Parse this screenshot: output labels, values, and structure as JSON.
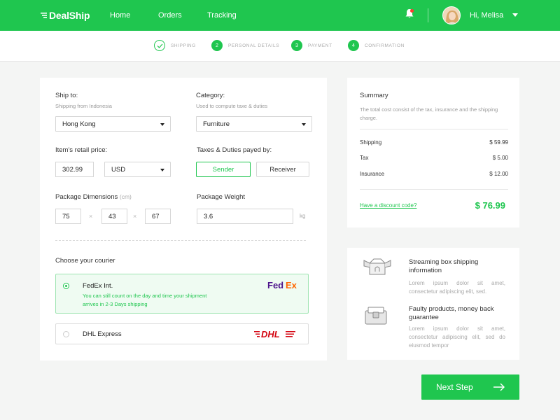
{
  "brand": {
    "name": "DealShip"
  },
  "nav": {
    "home": "Home",
    "orders": "Orders",
    "tracking": "Tracking"
  },
  "user": {
    "greeting": "Hi, Melisa"
  },
  "steps": [
    {
      "num": "",
      "label": "SHIPPING",
      "status": "done"
    },
    {
      "num": "2",
      "label": "PERSONAL DETAILS",
      "status": "active"
    },
    {
      "num": "3",
      "label": "PAYMENT",
      "status": "active"
    },
    {
      "num": "4",
      "label": "CONFIRMATION",
      "status": "active"
    }
  ],
  "form": {
    "ship_to": {
      "label": "Ship to:",
      "hint": "Shipping from Indonesia",
      "value": "Hong Kong"
    },
    "category": {
      "label": "Category:",
      "hint": "Used to compute taxe & duties",
      "value": "Furniture"
    },
    "retail_price": {
      "label": "Item's retail price:",
      "value": "302.99",
      "currency": "USD"
    },
    "payer": {
      "label": "Taxes & Duties payed by:",
      "sender": "Sender",
      "receiver": "Receiver",
      "selected": "Sender"
    },
    "dimensions": {
      "label": "Package Dimensions",
      "unit": "(cm)",
      "length": "75",
      "width": "43",
      "height": "67",
      "separator": "×"
    },
    "weight": {
      "label": "Package Weight",
      "value": "3.6",
      "unit": "kg"
    },
    "courier": {
      "label": "Choose your courier",
      "options": [
        {
          "name": "FedEx Int.",
          "note": "You can still count on the day and time your shipment arrives in 2-3 Days shipping",
          "logo": "FedEx",
          "selected": true
        },
        {
          "name": "DHL Express",
          "logo": "DHL",
          "selected": false
        }
      ]
    }
  },
  "summary": {
    "title": "Summary",
    "description": "The total cost consist of the tax, insurance and the shipping charge.",
    "rows": [
      {
        "label": "Shipping",
        "value": "$ 59.99"
      },
      {
        "label": "Tax",
        "value": "$ 5.00"
      },
      {
        "label": "Insurance",
        "value": "$ 12.00"
      }
    ],
    "discount_link": "Have a discount code?",
    "total": "$ 76.99"
  },
  "info": [
    {
      "title": "Streaming box shipping information",
      "text": "Lorem ipsum dolor sit amet, consectetur adipiscing elit, sed.",
      "icon": "open-box-icon"
    },
    {
      "title": "Faulty products, money back guarantee",
      "text": "Lorem ipsum dolor sit amet, consectetur adipiscing elit, sed do eiusmod tempor",
      "icon": "wallet-icon"
    }
  ],
  "next_button": {
    "label": "Next Step"
  },
  "colors": {
    "brand": "#1fc64f",
    "fedex_purple": "#4d148c",
    "fedex_orange": "#ff6600",
    "dhl_red": "#d40511"
  }
}
